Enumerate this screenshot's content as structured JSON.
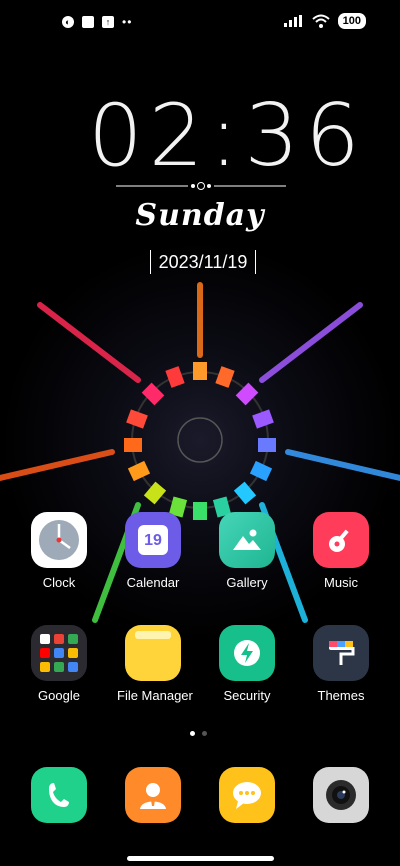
{
  "status_bar": {
    "left_icons": [
      "app-notification-icon",
      "square-notification-icon",
      "upload-icon"
    ],
    "more_dots": "••",
    "battery": "100"
  },
  "lock": {
    "time": "02:36",
    "day": "Sunday",
    "date": "2023/11/19"
  },
  "apps": [
    {
      "label": "Clock"
    },
    {
      "label": "Calendar",
      "icon_text": "19"
    },
    {
      "label": "Gallery"
    },
    {
      "label": "Music"
    },
    {
      "label": "Google"
    },
    {
      "label": "File Manager"
    },
    {
      "label": "Security"
    },
    {
      "label": "Themes"
    }
  ],
  "dock": [
    "Phone",
    "Contacts",
    "Messages",
    "Camera"
  ],
  "colors": {
    "calendar": "#6c5ce7",
    "gallery": "#2ec4a6",
    "music": "#ff3d5a",
    "file_manager": "#ffd43b",
    "security": "#17c08b",
    "phone": "#1fd18a",
    "contacts": "#ff8a2a",
    "messages": "#ffc21a",
    "camera": "#d7d7d7"
  },
  "page_indicator": {
    "count": 2,
    "active": 1
  }
}
